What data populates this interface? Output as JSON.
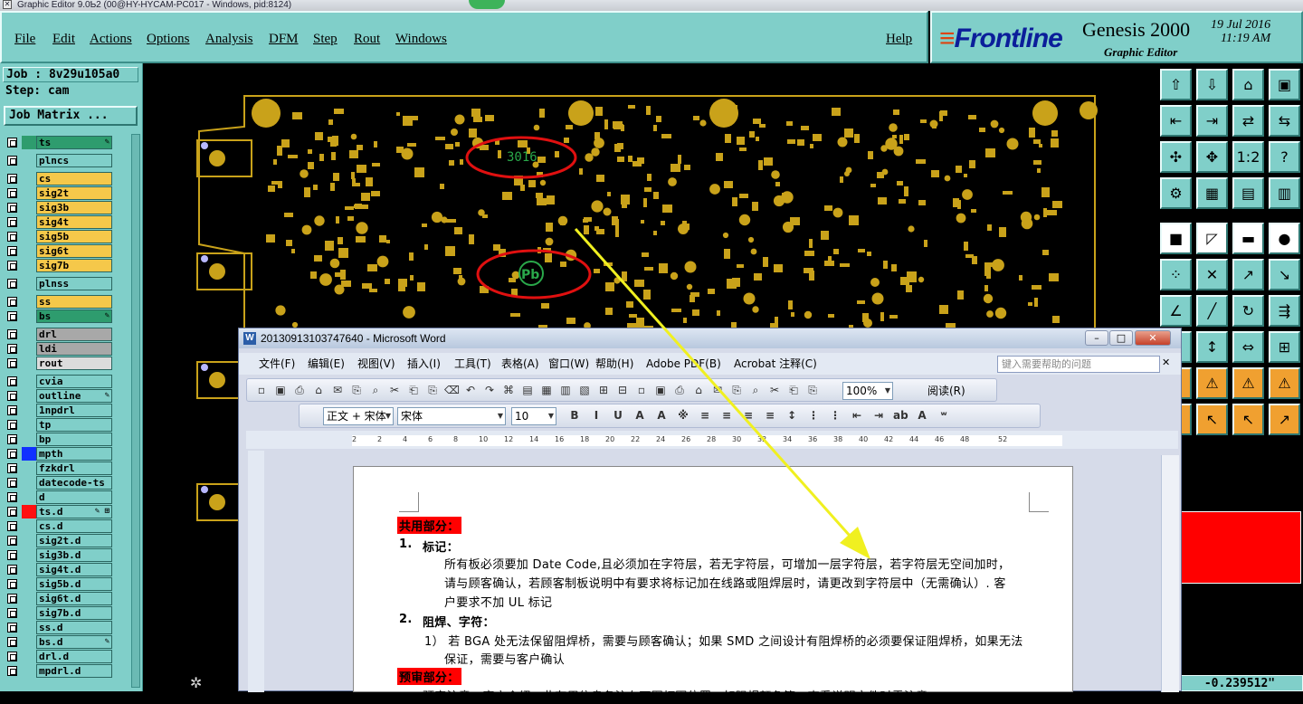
{
  "title_bar": "Graphic Editor 9.0Ƅ2 (00@HY-HYCAM-PC017 - Windows, pid:8124)",
  "menu": [
    "File",
    "Edit",
    "Actions",
    "Options",
    "Analysis",
    "DFM",
    "Step",
    "Rout",
    "Windows"
  ],
  "help": "Help",
  "brand": {
    "logo": "Frontline",
    "product": "Genesis 2000",
    "subtitle": "Graphic Editor",
    "date": "19 Jul 2016",
    "time": "11:19 AM"
  },
  "job": {
    "job_label": "Job : 8v29u105a0",
    "step_label": "Step: cam",
    "matrix_button": "Job Matrix ..."
  },
  "layers": [
    {
      "name": "ts",
      "bg": "#2e9c6e",
      "swatch": "#2e9c6e",
      "icon": "✎"
    },
    {
      "name": "plncs",
      "bg": "#80cfc9",
      "swatch": "",
      "icon": ""
    },
    {
      "name": "cs",
      "bg": "#f5c84a",
      "swatch": "",
      "icon": ""
    },
    {
      "name": "sig2t",
      "bg": "#f5c84a",
      "swatch": "",
      "icon": ""
    },
    {
      "name": "sig3b",
      "bg": "#f5c84a",
      "swatch": "",
      "icon": ""
    },
    {
      "name": "sig4t",
      "bg": "#f5c84a",
      "swatch": "",
      "icon": ""
    },
    {
      "name": "sig5b",
      "bg": "#f5c84a",
      "swatch": "",
      "icon": ""
    },
    {
      "name": "sig6t",
      "bg": "#f5c84a",
      "swatch": "",
      "icon": ""
    },
    {
      "name": "sig7b",
      "bg": "#f5c84a",
      "swatch": "",
      "icon": ""
    },
    {
      "name": "plnss",
      "bg": "#80cfc9",
      "swatch": "",
      "icon": ""
    },
    {
      "name": "ss",
      "bg": "#f5c84a",
      "swatch": "",
      "icon": ""
    },
    {
      "name": "bs",
      "bg": "#2e9c6e",
      "swatch": "",
      "icon": "✎"
    },
    {
      "name": "drl",
      "bg": "#a8a8a8",
      "swatch": "",
      "icon": ""
    },
    {
      "name": "ldi",
      "bg": "#a8a8a8",
      "swatch": "",
      "icon": ""
    },
    {
      "name": "rout",
      "bg": "#dcdcdc",
      "swatch": "",
      "icon": ""
    },
    {
      "name": "cvia",
      "bg": "#80cfc9",
      "swatch": "",
      "icon": ""
    },
    {
      "name": "outline",
      "bg": "#80cfc9",
      "swatch": "",
      "icon": "✎"
    },
    {
      "name": "1npdrl",
      "bg": "#80cfc9",
      "swatch": "",
      "icon": ""
    },
    {
      "name": "tp",
      "bg": "#80cfc9",
      "swatch": "",
      "icon": ""
    },
    {
      "name": "bp",
      "bg": "#80cfc9",
      "swatch": "",
      "icon": ""
    },
    {
      "name": "mpth",
      "bg": "#80cfc9",
      "swatch": "#1030ff",
      "icon": ""
    },
    {
      "name": "fzkdrl",
      "bg": "#80cfc9",
      "swatch": "",
      "icon": ""
    },
    {
      "name": "datecode-ts",
      "bg": "#80cfc9",
      "swatch": "",
      "icon": ""
    },
    {
      "name": "d",
      "bg": "#80cfc9",
      "swatch": "",
      "icon": ""
    },
    {
      "name": "ts.d",
      "bg": "#80cfc9",
      "swatch": "#ff1010",
      "icon": "✎ ⊞"
    },
    {
      "name": "cs.d",
      "bg": "#80cfc9",
      "swatch": "",
      "icon": ""
    },
    {
      "name": "sig2t.d",
      "bg": "#80cfc9",
      "swatch": "",
      "icon": ""
    },
    {
      "name": "sig3b.d",
      "bg": "#80cfc9",
      "swatch": "",
      "icon": ""
    },
    {
      "name": "sig4t.d",
      "bg": "#80cfc9",
      "swatch": "",
      "icon": ""
    },
    {
      "name": "sig5b.d",
      "bg": "#80cfc9",
      "swatch": "",
      "icon": ""
    },
    {
      "name": "sig6t.d",
      "bg": "#80cfc9",
      "swatch": "",
      "icon": ""
    },
    {
      "name": "sig7b.d",
      "bg": "#80cfc9",
      "swatch": "",
      "icon": ""
    },
    {
      "name": "ss.d",
      "bg": "#80cfc9",
      "swatch": "",
      "icon": ""
    },
    {
      "name": "bs.d",
      "bg": "#80cfc9",
      "swatch": "",
      "icon": "✎"
    },
    {
      "name": "drl.d",
      "bg": "#80cfc9",
      "swatch": "",
      "icon": ""
    },
    {
      "name": "mpdrl.d",
      "bg": "#80cfc9",
      "swatch": "",
      "icon": ""
    }
  ],
  "canvas_labels": {
    "datecode": "3016",
    "pb": "Pb"
  },
  "coord": "-0.239512\"",
  "word": {
    "title": "20130913103747640 - Microsoft Word",
    "menu": [
      "文件(F)",
      "编辑(E)",
      "视图(V)",
      "插入(I)",
      "工具(T)",
      "表格(A)",
      "窗口(W)",
      "帮助(H)",
      "Adobe PDF(B)",
      "Acrobat 注释(C)"
    ],
    "search_placeholder": "键入需要帮助的问题",
    "zoom": "100%",
    "read_label": "阅读(R)",
    "style": "正文 + 宋体",
    "font": "宋体",
    "size": "10",
    "ruler_numbers": [
      "2",
      "2",
      "4",
      "6",
      "8",
      "10",
      "12",
      "14",
      "16",
      "18",
      "20",
      "22",
      "24",
      "26",
      "28",
      "30",
      "32",
      "34",
      "36",
      "38",
      "40",
      "42",
      "44",
      "46",
      "48",
      "52"
    ],
    "lines": [
      "共用部分：",
      "1.",
      "标记：",
      "所有板必须要加 Date Code,且必须加在字符层，若无字符层，可增加一层字符层，若字符层无空间加时，",
      "请与顾客确认，若顾客制板说明中有要求将标记加在线路或阻焊层时，请更改到字符层中（无需确认）. 客",
      "户要求不加 UL 标记",
      "2.",
      "阻焊、字符：",
      "1） 若 BGA 处无法保留阻焊桥，需要与顾客确认；如果 SMD 之间设计有阻焊桥的必须要保证阻焊桥，如果无法",
      "保证，需要与客户确认",
      "预审部分：",
      "预审注意，客户介绍，此有用信息各注在下图打圈位置，如阻焊颜色等，查看说明文件时需注意。"
    ]
  },
  "colors": {
    "teal": "#80cfc9",
    "pad": "#c9a21a",
    "ellipse": "#e01010",
    "arrow": "#f0f020"
  }
}
